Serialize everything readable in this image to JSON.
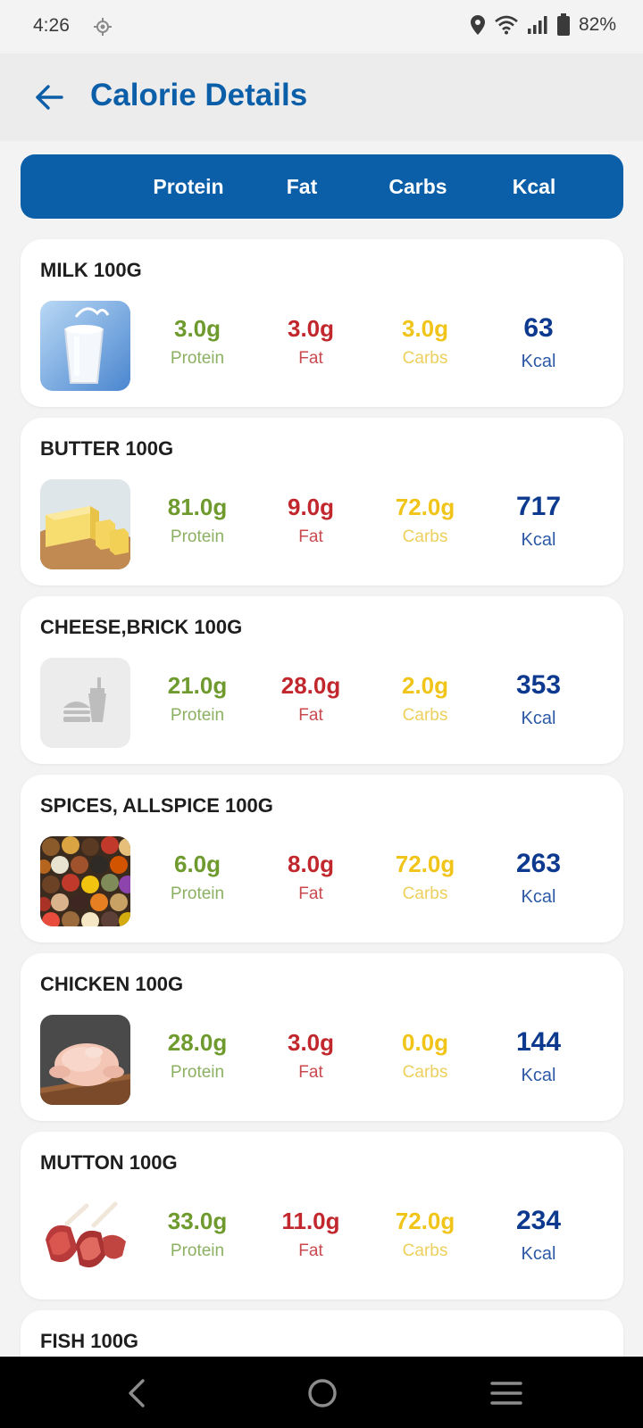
{
  "status_bar": {
    "time": "4:26",
    "battery": "82%"
  },
  "app_bar": {
    "title": "Calorie Details"
  },
  "header": {
    "protein": "Protein",
    "fat": "Fat",
    "carbs": "Carbs",
    "kcal": "Kcal"
  },
  "colors": {
    "primary": "#0b5ea8",
    "protein": "#6e9a2e",
    "fat": "#c1272d",
    "carbs": "#f0c419",
    "kcal": "#0d3a8e"
  },
  "labels": {
    "protein": "Protein",
    "fat": "Fat",
    "carbs": "Carbs",
    "kcal": "Kcal"
  },
  "foods": [
    {
      "name": "MILK 100G",
      "protein": "3.0g",
      "fat": "3.0g",
      "carbs": "3.0g",
      "kcal": "63",
      "image": "milk-glass"
    },
    {
      "name": "BUTTER 100G",
      "protein": "81.0g",
      "fat": "9.0g",
      "carbs": "72.0g",
      "kcal": "717",
      "image": "butter-block"
    },
    {
      "name": "CHEESE,BRICK 100G",
      "protein": "21.0g",
      "fat": "28.0g",
      "carbs": "2.0g",
      "kcal": "353",
      "image": "fastfood-placeholder-icon"
    },
    {
      "name": "SPICES, ALLSPICE 100G",
      "protein": "6.0g",
      "fat": "8.0g",
      "carbs": "72.0g",
      "kcal": "263",
      "image": "spices-bowls"
    },
    {
      "name": "CHICKEN 100G",
      "protein": "28.0g",
      "fat": "3.0g",
      "carbs": "0.0g",
      "kcal": "144",
      "image": "raw-chicken"
    },
    {
      "name": "MUTTON 100G",
      "protein": "33.0g",
      "fat": "11.0g",
      "carbs": "72.0g",
      "kcal": "234",
      "image": "mutton-chops"
    },
    {
      "name": "FISH 100G"
    }
  ]
}
